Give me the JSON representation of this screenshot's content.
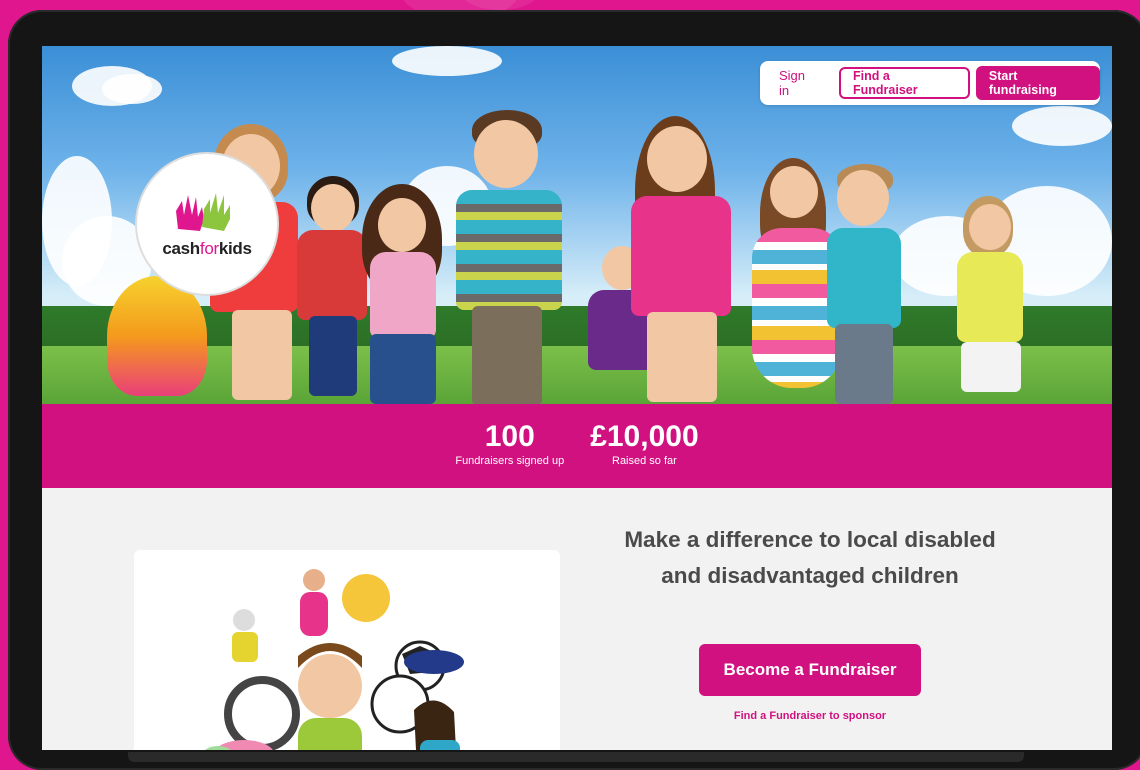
{
  "brand": {
    "name_cash": "cash",
    "name_for": "for",
    "name_kids": "kids",
    "accent": "#d0117f"
  },
  "nav": {
    "sign_in": "Sign in",
    "find_fundraiser": "Find a Fundraiser",
    "start_fundraising": "Start fundraising"
  },
  "stats": [
    {
      "value": "100",
      "label": "Fundraisers signed up"
    },
    {
      "value": "£10,000",
      "label": "Raised so far"
    }
  ],
  "main": {
    "headline": "Make a difference to local disabled and disadvantaged children",
    "cta": "Become a Fundraiser",
    "cta_link": "Find a Fundraiser to sponsor"
  },
  "icons": [
    "hands-logo-icon"
  ]
}
